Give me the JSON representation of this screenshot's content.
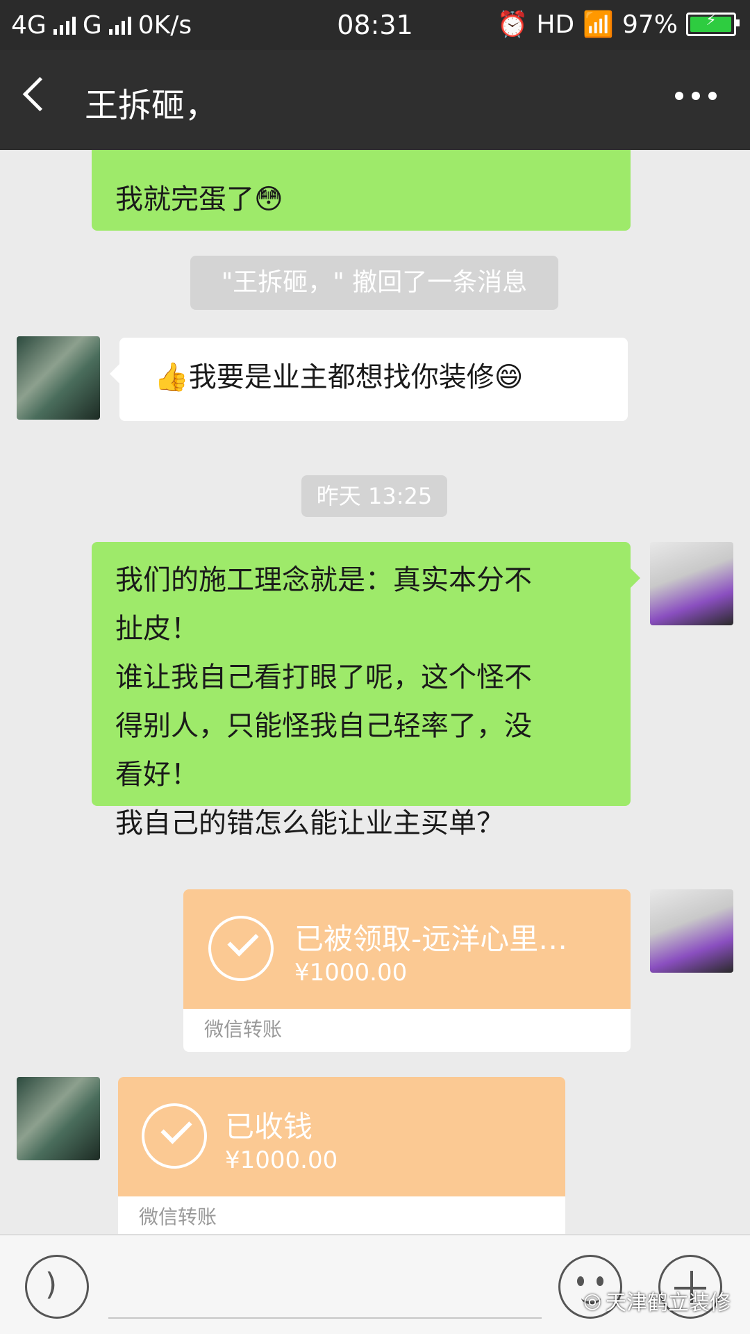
{
  "status_bar": {
    "network1": "4G",
    "network2": "G",
    "speed": "0K/s",
    "time": "08:31",
    "hd": "HD",
    "battery": "97%",
    "alarm_icon": "alarm-icon",
    "wifi_icon": "wifi-icon"
  },
  "header": {
    "title": "王拆砸，",
    "back_icon": "back-arrow-icon",
    "more_icon": "more-icon"
  },
  "messages": [
    {
      "type": "text",
      "side": "right",
      "text": "我就完蛋了😳"
    },
    {
      "type": "system",
      "text": "\"王拆砸，\" 撤回了一条消息"
    },
    {
      "type": "text",
      "side": "left",
      "text": "👍我要是业主都想找你装修😄"
    },
    {
      "type": "time",
      "text": "昨天 13:25"
    },
    {
      "type": "text",
      "side": "right",
      "lines": [
        "我们的施工理念就是：真实本分不",
        "扯皮！",
        "谁让我自己看打眼了呢，这个怪不",
        "得别人，只能怪我自己轻率了，没",
        "看好！",
        "我自己的错怎么能让业主买单？"
      ]
    },
    {
      "type": "transfer",
      "side": "right",
      "title": "已被领取-远洋心里…",
      "amount": "¥1000.00",
      "footer": "微信转账"
    },
    {
      "type": "transfer",
      "side": "left",
      "title": "已收钱",
      "amount": "¥1000.00",
      "footer": "微信转账"
    }
  ],
  "input_bar": {
    "voice_icon": "voice-icon",
    "emoji_icon": "emoji-icon",
    "plus_icon": "plus-icon"
  },
  "watermark": "天津鹤立装修",
  "colors": {
    "green_bubble": "#9eea6a",
    "transfer": "#fbc993",
    "header": "#2f2f2f"
  }
}
